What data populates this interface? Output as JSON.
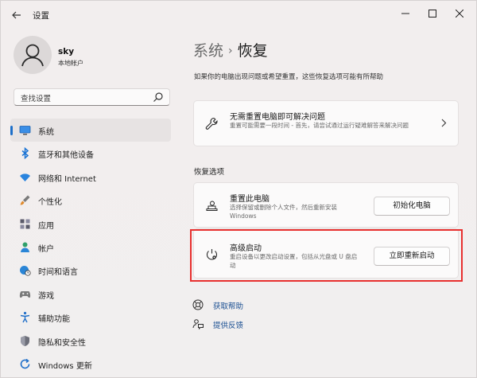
{
  "window": {
    "title": "设置"
  },
  "user": {
    "name": "sky",
    "account_type": "本地帐户"
  },
  "search": {
    "placeholder": "查找设置"
  },
  "nav": {
    "items": [
      {
        "label": "系统",
        "icon": "monitor-icon",
        "selected": true
      },
      {
        "label": "蓝牙和其他设备",
        "icon": "bluetooth-icon"
      },
      {
        "label": "网络和 Internet",
        "icon": "wifi-icon"
      },
      {
        "label": "个性化",
        "icon": "brush-icon"
      },
      {
        "label": "应用",
        "icon": "apps-icon"
      },
      {
        "label": "帐户",
        "icon": "person-icon"
      },
      {
        "label": "时间和语言",
        "icon": "globe-clock-icon"
      },
      {
        "label": "游戏",
        "icon": "gamepad-icon"
      },
      {
        "label": "辅助功能",
        "icon": "accessibility-icon"
      },
      {
        "label": "隐私和安全性",
        "icon": "shield-icon"
      },
      {
        "label": "Windows 更新",
        "icon": "update-icon"
      }
    ]
  },
  "main": {
    "breadcrumb": {
      "parent": "系统",
      "separator": "›",
      "current": "恢复"
    },
    "description": "如果你的电脑出现问题或希望重置，这些恢复选项可能有所帮助",
    "fix_card": {
      "title": "无需重置电脑即可解决问题",
      "description": "重置可能需要一段时间 - 首先，请尝试通过运行疑难解答来解决问题"
    },
    "section_heading": "恢复选项",
    "reset_card": {
      "title": "重置此电脑",
      "description": "选择保留或删除个人文件，然后重新安装 Windows",
      "button": "初始化电脑"
    },
    "advanced_card": {
      "title": "高级启动",
      "description": "重启设备以更改启动设置，包括从光盘或 U 盘启动",
      "button": "立即重新启动"
    },
    "links": [
      {
        "label": "获取帮助",
        "icon": "help-icon"
      },
      {
        "label": "提供反馈",
        "icon": "feedback-icon"
      }
    ]
  },
  "colors": {
    "accent": "#1d6fc9",
    "highlight": "#e8302f",
    "link": "#1a4f92"
  }
}
